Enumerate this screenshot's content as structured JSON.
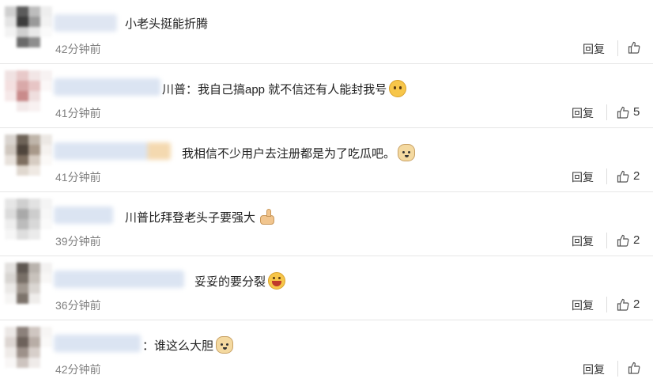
{
  "comments": [
    {
      "text": "小老头挺能折腾",
      "emoji": "",
      "time": "42分钟前",
      "reply": "回复",
      "likes": ""
    },
    {
      "text": "川普：我自己搞app 就不信还有人能封我号",
      "emoji": "face",
      "time": "41分钟前",
      "reply": "回复",
      "likes": "5"
    },
    {
      "text": "我相信不少用户去注册都是为了吃瓜吧。",
      "emoji": "doge",
      "time": "41分钟前",
      "reply": "回复",
      "likes": "2"
    },
    {
      "text": "川普比拜登老头子要强大",
      "emoji": "thumb",
      "time": "39分钟前",
      "reply": "回复",
      "likes": "2"
    },
    {
      "text": "妥妥的要分裂",
      "emoji": "grin",
      "time": "36分钟前",
      "reply": "回复",
      "likes": "2"
    },
    {
      "text": "：谁这么大胆",
      "emoji": "doge",
      "time": "42分钟前",
      "reply": "回复",
      "likes": ""
    }
  ]
}
